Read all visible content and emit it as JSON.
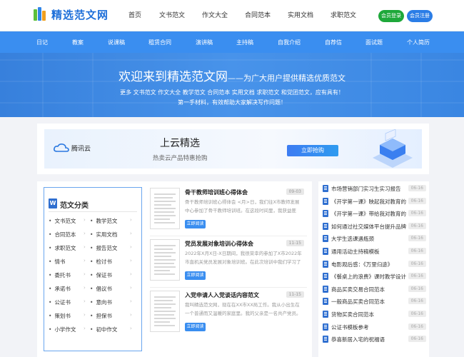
{
  "brand": {
    "logo_text": "精选范文网",
    "colors": {
      "primary": "#1e6fd9",
      "nav": "#3a8ef0",
      "login": "#1ea83a",
      "register": "#2b7de6"
    }
  },
  "topnav": [
    "首页",
    "文书范文",
    "作文大全",
    "合同范本",
    "实用文档",
    "求职范文"
  ],
  "auth": {
    "login": "会员登录",
    "register": "会员注册"
  },
  "catnav": [
    "日记",
    "教案",
    "说课稿",
    "租赁合同",
    "演讲稿",
    "主持稿",
    "自我介绍",
    "自荐信",
    "面试题",
    "个人简历"
  ],
  "hero": {
    "title": "欢迎来到精选范文网",
    "subtitle": "——为广大用户提供精选优质范文",
    "line1": "更多 文书范文 作文大全 教学范文 合同范本 实用文档 求职范文 和党团范文，应有具有！",
    "line2": "第一手材料，有效帮助大家解决写作问题！"
  },
  "banner": {
    "brand": "腾讯云",
    "title": "上云精选",
    "subtitle": "热卖云产品特惠抢购",
    "cta": "立即抢购"
  },
  "categories": {
    "title": "范文分类",
    "items": [
      "文书范文",
      "教学范文",
      "合同范本",
      "实用文档",
      "求职范文",
      "报告范文",
      "情书",
      "检讨书",
      "委托书",
      "保证书",
      "承诺书",
      "倡议书",
      "公证书",
      "意向书",
      "策划书",
      "担保书",
      "小学作文",
      "初中作文"
    ]
  },
  "articles": [
    {
      "title": "骨干教师培训班心得体会",
      "date": "09-03",
      "desc": "骨干教师培训班心得体会 <月>日，我们往X市教师发展中心参加了骨干教师培训班。在这段时间里，我获益匪浅。",
      "button": "立即阅读"
    },
    {
      "title": "党员发展对象培训心得体会",
      "date": "11-15",
      "desc": "2022年X月X日-X日期间，我很荣幸的参加了X市2022年市直机关党员发展对象培训班。在此次培训中我们学习了",
      "button": "立即阅读"
    },
    {
      "title": "入党申请人入党谈话内容范文",
      "date": "11-15",
      "desc": "我叫精选范文网，现在在XX市XX局工作。我从小出生在一个普通而又温暖的家庭里。我的父亲是一名共产党员。",
      "button": "立即阅读"
    }
  ],
  "hotlist": [
    {
      "text": "市场营销部门实习生实习报告",
      "date": "06-16"
    },
    {
      "text": "《开学第一课》映起我对教育的",
      "date": "06-16"
    },
    {
      "text": "《开学第一课》带给我对教育的",
      "date": "06-16"
    },
    {
      "text": "如何通过社交媒体平台提升品牌",
      "date": "06-16"
    },
    {
      "text": "大学生选课遇瓶颈",
      "date": "06-16"
    },
    {
      "text": "通用活动主持稿模板",
      "date": "06-16"
    },
    {
      "text": "电影观后感：《万里归途》",
      "date": "06-16"
    },
    {
      "text": "《餐桌上的浪费》课时教学设计",
      "date": "06-16"
    },
    {
      "text": "商品买卖交易合同范本",
      "date": "06-16"
    },
    {
      "text": "一般商品买卖合同范本",
      "date": "06-16"
    },
    {
      "text": "货物买卖合同范本",
      "date": "06-16"
    },
    {
      "text": "公证书模板参考",
      "date": "06-16"
    },
    {
      "text": "恭喜新居入宅的祝福语",
      "date": "06-16"
    }
  ]
}
